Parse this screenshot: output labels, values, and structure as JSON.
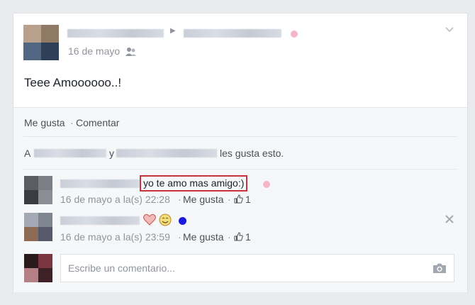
{
  "post": {
    "date": "16 de mayo",
    "body_text": "Teee Amoooooo..!",
    "actions": {
      "like": "Me gusta",
      "separator": "·",
      "comment": "Comentar"
    },
    "likes_line": {
      "prefix": "A",
      "conjunction": "y",
      "suffix": "les gusta esto."
    }
  },
  "comments": [
    {
      "text": "yo te amo mas amigo:)",
      "timestamp": "16 de mayo a la(s) 22:28",
      "like_label": "Me gusta",
      "like_count": "1",
      "highlight_color": "#d9534f"
    },
    {
      "timestamp": "16 de mayo a la(s) 23:59",
      "like_label": "Me gusta",
      "like_count": "1",
      "emoji": [
        "heart",
        "smile",
        "blue-dot"
      ]
    }
  ],
  "composer": {
    "placeholder": "Escribe un comentario..."
  },
  "colors": {
    "link": "#4b4f56",
    "meta": "#90949c",
    "pink_dot": "#f4b6c6",
    "blue_dot": "#1a1adf",
    "heart": "#e58b8b"
  }
}
